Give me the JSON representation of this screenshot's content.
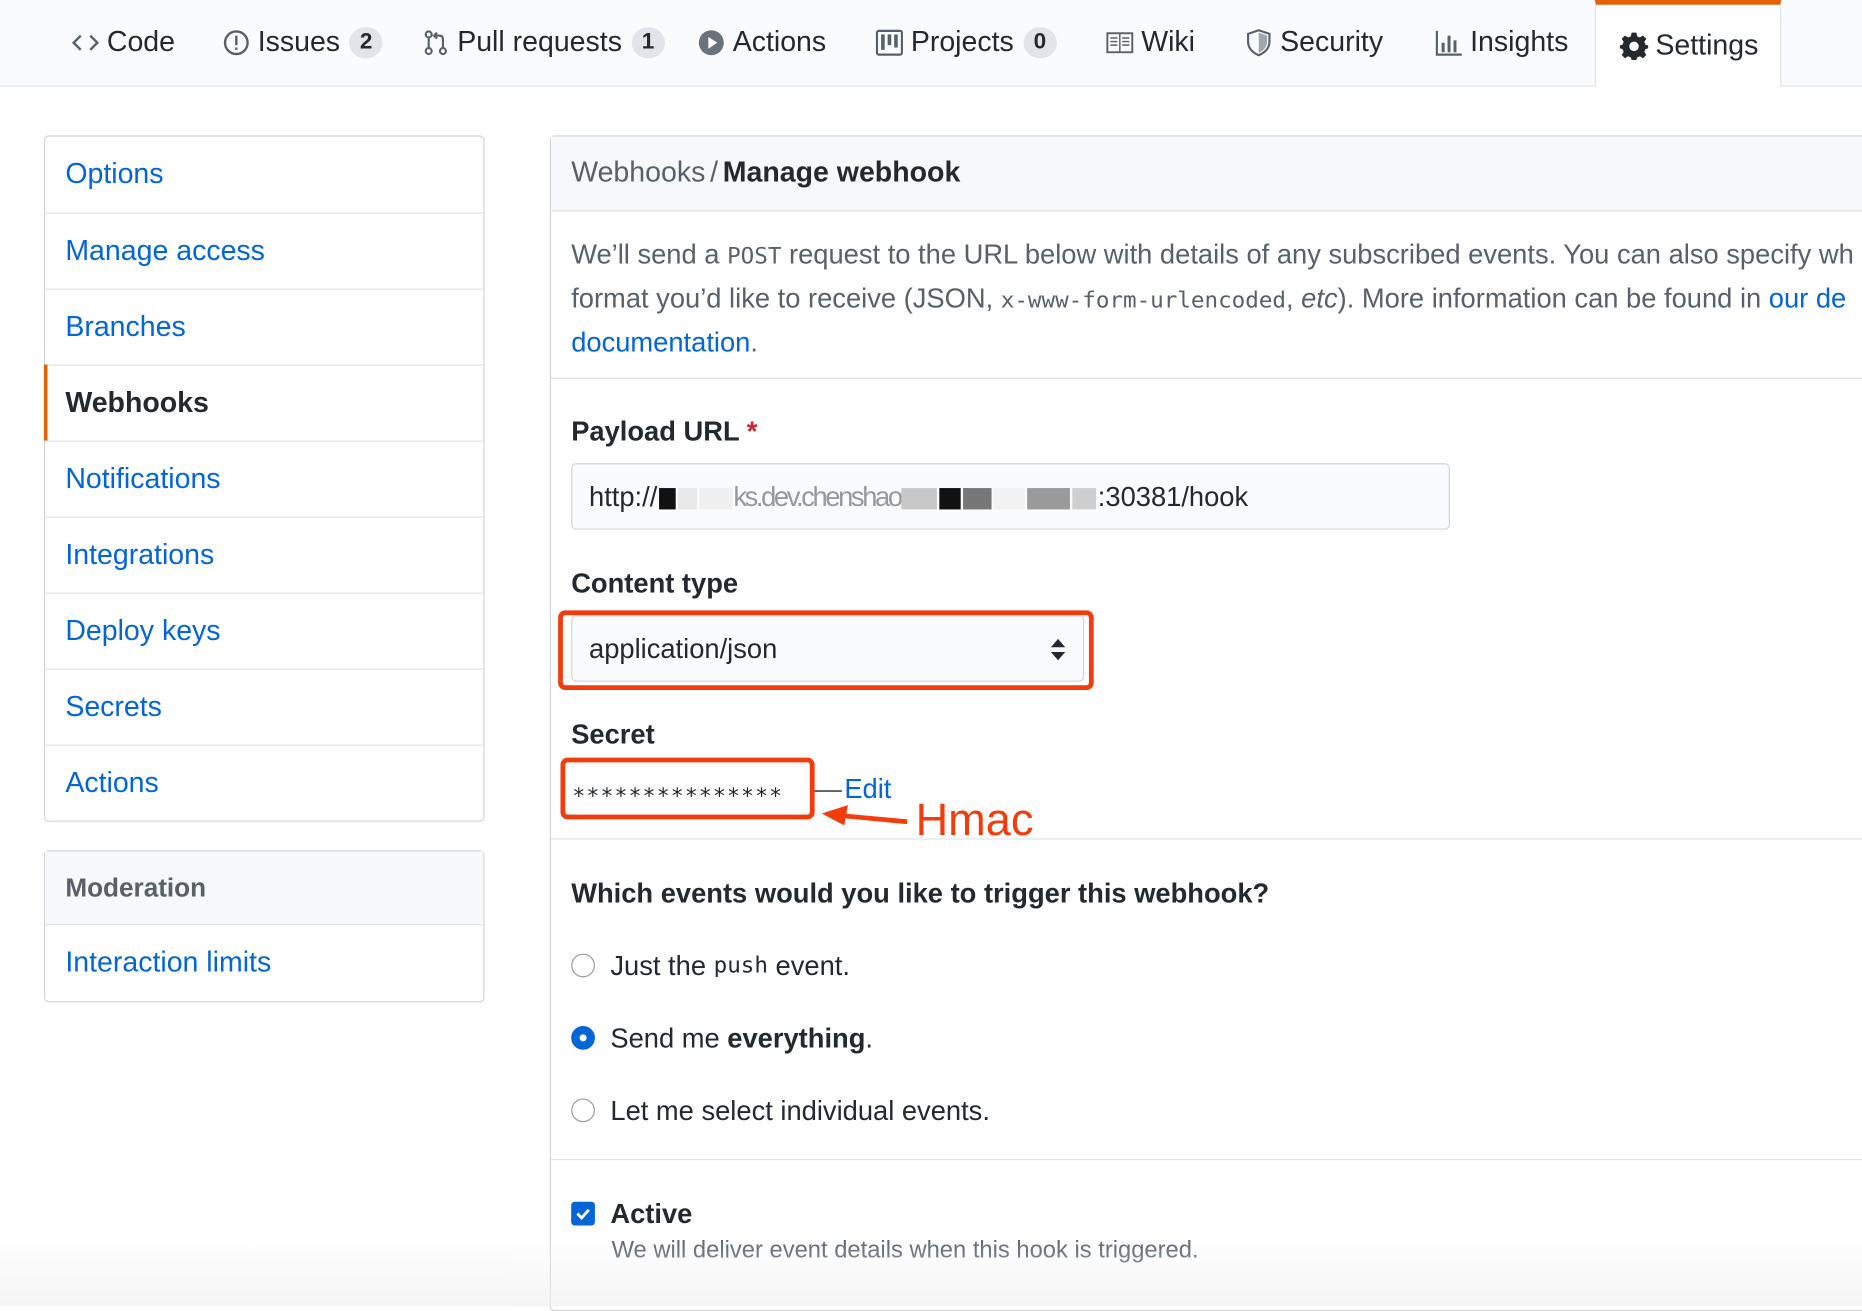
{
  "nav": {
    "tabs": [
      {
        "label": "Code",
        "icon": "code-icon"
      },
      {
        "label": "Issues",
        "icon": "issue-opened-icon",
        "count": "2"
      },
      {
        "label": "Pull requests",
        "icon": "git-pull-request-icon",
        "count": "1"
      },
      {
        "label": "Actions",
        "icon": "play-icon"
      },
      {
        "label": "Projects",
        "icon": "project-icon",
        "count": "0"
      },
      {
        "label": "Wiki",
        "icon": "book-icon"
      },
      {
        "label": "Security",
        "icon": "shield-icon"
      },
      {
        "label": "Insights",
        "icon": "graph-icon"
      },
      {
        "label": "Settings",
        "icon": "gear-icon",
        "selected": true
      }
    ]
  },
  "sidebar": {
    "items": [
      {
        "label": "Options"
      },
      {
        "label": "Manage access"
      },
      {
        "label": "Branches"
      },
      {
        "label": "Webhooks",
        "selected": true
      },
      {
        "label": "Notifications"
      },
      {
        "label": "Integrations"
      },
      {
        "label": "Deploy keys"
      },
      {
        "label": "Secrets"
      },
      {
        "label": "Actions"
      }
    ],
    "moderation_heading": "Moderation",
    "moderation_items": [
      {
        "label": "Interaction limits"
      }
    ]
  },
  "webhook": {
    "breadcrumb_parent": "Webhooks",
    "breadcrumb_sep": "/",
    "breadcrumb_current": "Manage webhook",
    "intro": {
      "t1": "We’ll send a ",
      "code1": "POST",
      "t2": " request to the URL below with details of any subscribed events. You can also specify wh",
      "t3": "format you’d like to receive (JSON, ",
      "code2": "x-www-form-urlencoded",
      "t4": ", ",
      "etc": "etc",
      "t5": "). More information can be found in ",
      "link1": "our de",
      "link2": "documentation",
      "t6": "."
    },
    "payload_label": "Payload URL",
    "required_mark": "*",
    "payload_prefix": "http://",
    "payload_mid": "ks.dev.chenshao",
    "payload_suffix": ":30381/hook",
    "content_type_label": "Content type",
    "content_type_value": "application/json",
    "secret_label": "Secret",
    "secret_value": "***************",
    "edit_dash": "—",
    "edit_label": "Edit",
    "annotation_label": "Hmac",
    "events_question": "Which events would you like to trigger this webhook?",
    "event_options": [
      {
        "pre": "Just the ",
        "code": "push",
        "post": " event.",
        "checked": false
      },
      {
        "pre": "Send me ",
        "bold": "everything",
        "post": ".",
        "checked": true
      },
      {
        "pre": "Let me select individual events.",
        "checked": false
      }
    ],
    "active_label": "Active",
    "active_checked": true,
    "active_desc": "We will deliver event details when this hook is triggered."
  },
  "colors": {
    "link": "#0366d6",
    "accent_orange": "#e36209",
    "annotation_red": "#f23c0c",
    "required_red": "#cb2431"
  }
}
